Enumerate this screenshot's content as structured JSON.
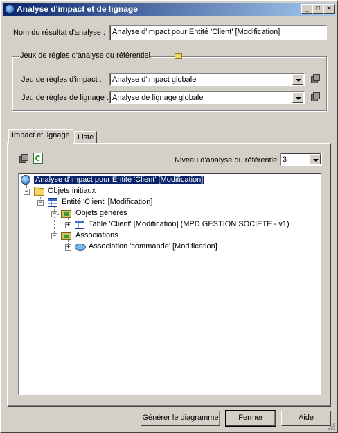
{
  "window": {
    "title": "Analyse d'impact et de lignage"
  },
  "result_name": {
    "label": "Nom du résultat d'analyse :",
    "value": "Analyse d'impact pour Entité 'Client' [Modification]"
  },
  "rules_group": {
    "legend": "Jeux de règles d'analyse du référentiel",
    "impact_label": "Jeu de règles d'impact :",
    "impact_value": "Analyse d'impact globale",
    "lineage_label": "Jeu de règles de lignage :",
    "lineage_value": "Analyse de lignage globale"
  },
  "tabs": [
    {
      "label": "Impact et lignage",
      "active": true
    },
    {
      "label": "Liste",
      "active": false
    }
  ],
  "analysis_level": {
    "label": "Niveau d'analyse du référentiel :",
    "value": "3"
  },
  "tree": {
    "root": "Analyse d'impact pour Entité 'Client' [Modification]",
    "initial_objects": "Objets initiaux",
    "entity": "Entité 'Client' [Modification]",
    "generated_objects": "Objets générés",
    "table": "Table 'Client' [Modification] (MPD GESTION SOCIETE - v1)",
    "associations": "Associations",
    "association": "Association 'commande' [Modification]"
  },
  "buttons": {
    "generate": "Générer le diagramme",
    "close": "Fermer",
    "help": "Aide"
  },
  "colors": {
    "titlebar_start": "#0a246a",
    "titlebar_end": "#a6caf0",
    "face": "#d4d0c8",
    "selection": "#0a246a"
  }
}
